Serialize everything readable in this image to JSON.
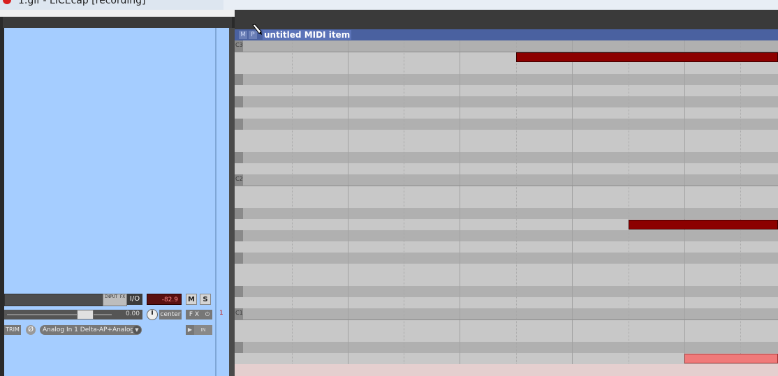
{
  "window": {
    "title": "1.gif - LICEcap [recording]"
  },
  "track": {
    "input_fx_label": "INPUT FX",
    "io_label": "I/O",
    "meter_value": "-82.9",
    "mute_label": "M",
    "solo_label": "S",
    "volume_value": "0.00",
    "pan_label": "center",
    "fx_label": "F X",
    "fx_power_label": "⏻",
    "track_number": "1",
    "trim_label": "TRIM",
    "phase_label": "Ø",
    "input_label": "Analog In 1 Delta-AP+Analog I",
    "record_monitor_label": "IN"
  },
  "midi_item": {
    "mute_label": "M",
    "solo_label": "P",
    "name": "untitled MIDI item"
  },
  "piano_roll": {
    "octave_labels": [
      "C3",
      "C2",
      "C1"
    ],
    "notes": [
      {
        "pitch": "B2",
        "color": "#8c0000"
      },
      {
        "pitch": "B1",
        "color": "#8c0000"
      },
      {
        "pitch": "G#0",
        "color": "#f07a7a",
        "selected": true
      }
    ]
  }
}
